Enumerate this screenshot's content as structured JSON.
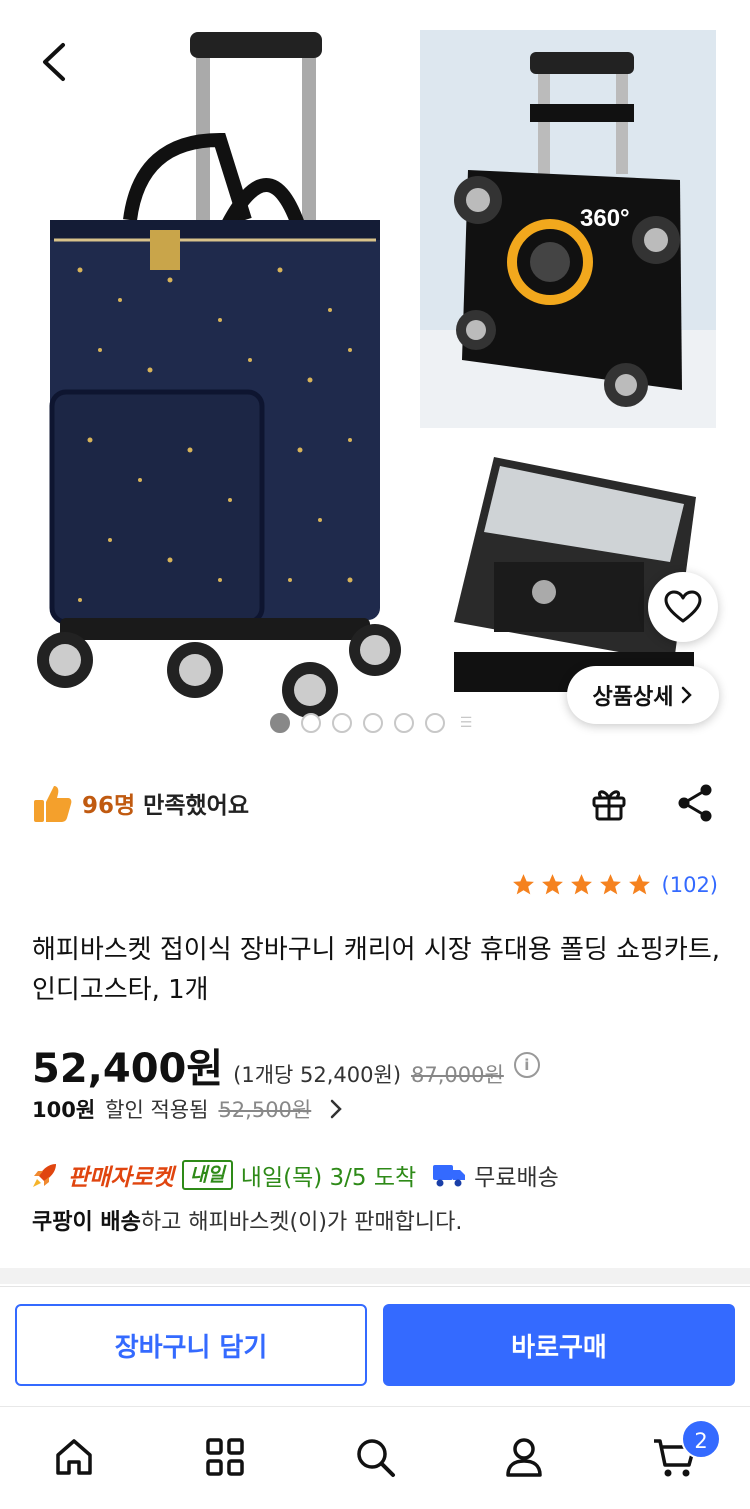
{
  "header": {
    "back_icon": "chevron-left-icon"
  },
  "gallery": {
    "image_count_dots": 6,
    "active_index": 0,
    "rotation_label": "360°",
    "detail_button": "상품상세"
  },
  "satisfaction": {
    "count": "96명",
    "label": " 만족했어요"
  },
  "rating": {
    "stars": 5,
    "count": "(102)"
  },
  "product": {
    "title": "해피바스켓 접이식 장바구니 캐리어 시장 휴대용 폴딩 쇼핑카트, 인디고스타, 1개"
  },
  "price": {
    "current": "52,400원",
    "unit": "(1개당 52,400원)",
    "original": "87,000원",
    "discount_amount": "100원",
    "discount_label": "할인 적용됨",
    "discount_original": "52,500원"
  },
  "delivery": {
    "rocket_label": "판매자로켓",
    "badge": "내일",
    "arrival": "내일(목) 3/5 도착",
    "free_shipping": "무료배송",
    "seller_bold": "쿠팡이 배송",
    "seller_rest": "하고 해피바스켓(이)가 판매합니다."
  },
  "cta": {
    "add_to_cart": "장바구니 담기",
    "buy_now": "바로구매"
  },
  "bottom_nav": {
    "cart_badge": "2"
  },
  "colors": {
    "accent": "#346aff",
    "rocket": "#e0450f",
    "arrival": "#2e8a18",
    "satisfaction": "#c05a10",
    "star": "#f5821f",
    "bag_navy": "#1f2a4c"
  }
}
